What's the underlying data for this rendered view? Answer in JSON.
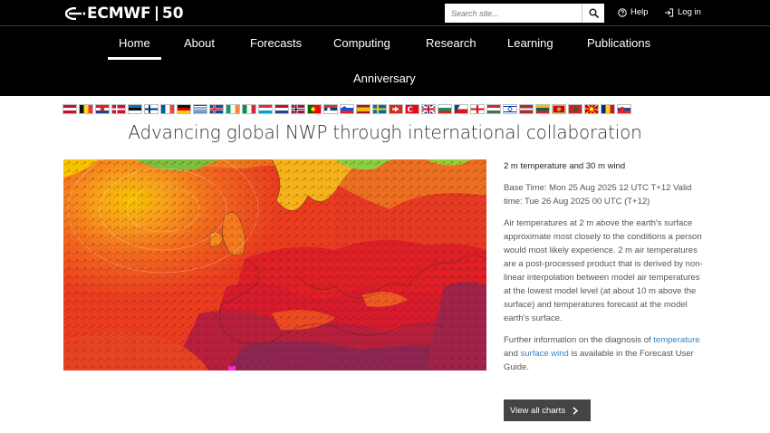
{
  "header": {
    "logo": {
      "brand": "ECMWF",
      "anniversary": "50",
      "icon": "ecmwf-logo-icon"
    },
    "search": {
      "placeholder": "Search site...",
      "icon": "search-icon"
    },
    "help_label": "Help",
    "login_label": "Log in"
  },
  "nav": {
    "items": [
      {
        "label": "Home",
        "active": true
      },
      {
        "label": "About"
      },
      {
        "label": "Forecasts"
      },
      {
        "label": "Computing"
      },
      {
        "label": "Research"
      },
      {
        "label": "Learning"
      },
      {
        "label": "Publications"
      },
      {
        "label": "Anniversary"
      }
    ]
  },
  "flags": [
    "austria",
    "belgium",
    "croatia",
    "denmark",
    "estonia",
    "finland",
    "france",
    "germany",
    "greece",
    "iceland",
    "ireland",
    "italy",
    "luxembourg",
    "netherlands",
    "norway",
    "portugal",
    "serbia",
    "slovenia",
    "spain",
    "sweden",
    "switzerland",
    "turkey",
    "united-kingdom",
    "bulgaria",
    "czechia",
    "georgia",
    "hungary",
    "israel",
    "latvia",
    "lithuania",
    "montenegro",
    "morocco",
    "north-macedonia",
    "romania",
    "slovakia"
  ],
  "main": {
    "title": "Advancing global NWP through international collaboration",
    "chart": {
      "heading": "2 m temperature and 30 m wind",
      "base_time": "Base Time: Mon 25 Aug 2025 12 UTC T+12 Valid time: Tue 26 Aug 2025 00 UTC (T+12)",
      "description": "Air temperatures at 2 m above the earth's surface approximate most closely to the conditions a person would most likely experience. 2 m air temperatures are a post-processed product that is derived by non-linear interpolation between model air temperatures at the lowest model level (at about 10 m above the surface) and temperatures forecast at the model earth's surface.",
      "further_prefix": "Further information on the diagnosis of ",
      "link_temperature": "temperature",
      "and_text": " and ",
      "link_wind": "surface wind",
      "further_suffix": " is available in the Forecast User Guide.",
      "button_label": "View all charts"
    }
  },
  "colors": {
    "header_bg": "#000000",
    "link": "#3a84c2",
    "button_bg": "#444444"
  }
}
